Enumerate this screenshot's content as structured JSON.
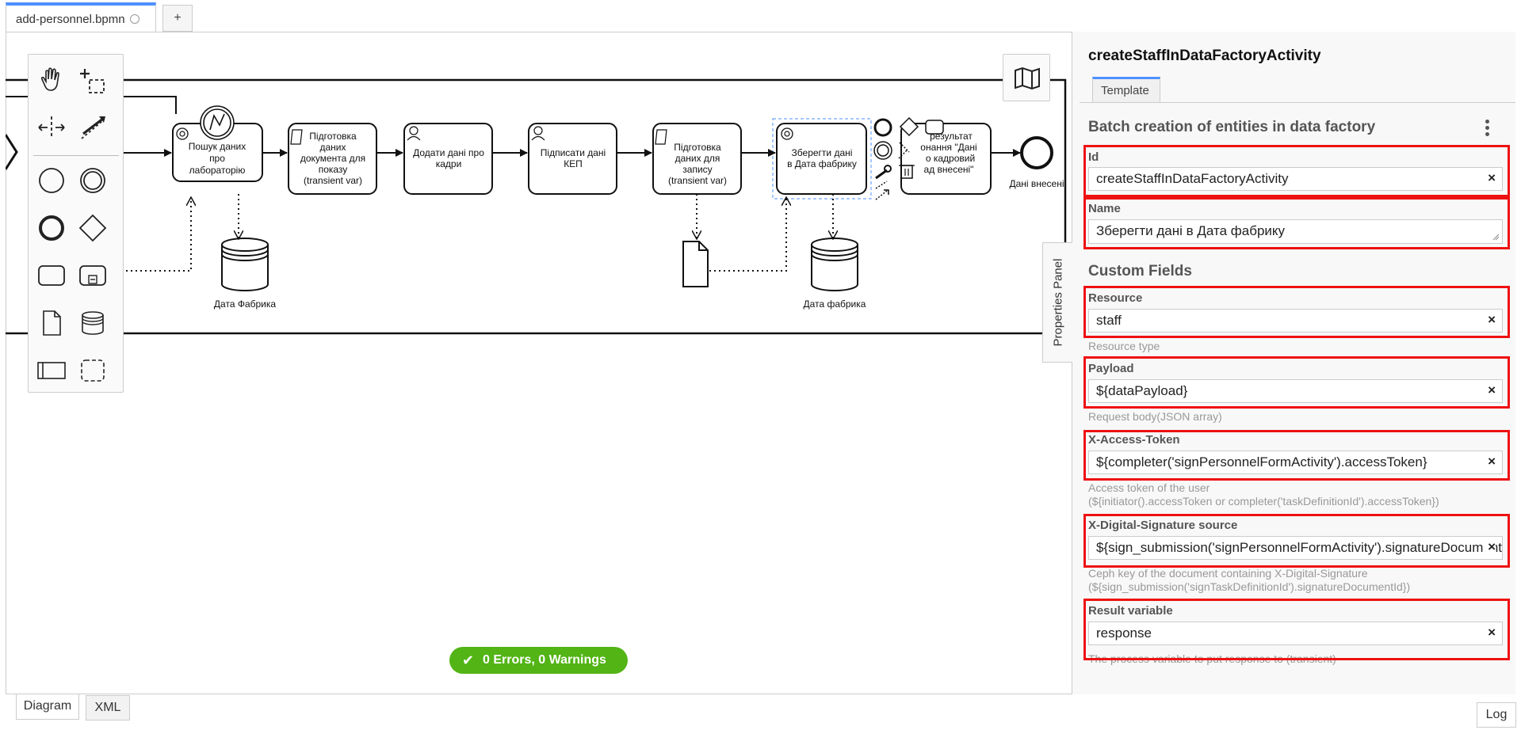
{
  "file_tab": {
    "name": "add-personnel.bpmn",
    "add_label": "+"
  },
  "diagram": {
    "tasks": [
      {
        "label": "Пошук даних про лабораторію"
      },
      {
        "label": "Підготовка даних документа для показу (transient var)"
      },
      {
        "label": "Додати дані про кадри"
      },
      {
        "label": "Підписати дані КЕП"
      },
      {
        "label": "Підготовка даних для запису (transient var)"
      },
      {
        "label": "Зберегти дані в Дата фабрику"
      },
      {
        "label": "...ультат ...онання \"Дані ...о кадровий ...ад внесені\""
      }
    ],
    "partial_task_text": "а\nа\nя",
    "stores": [
      {
        "label": "Дата Фабрика"
      },
      {
        "label": "Дата фабрика"
      }
    ],
    "end_event_label": "Дані внесені"
  },
  "panel": {
    "toggle_label": "Properties Panel",
    "element_id": "createStaffInDataFactoryActivity",
    "tab_label": "Template",
    "group_title": "Batch creation of entities in data factory",
    "id_field": {
      "label": "Id",
      "value": "createStaffInDataFactoryActivity"
    },
    "name_field": {
      "label": "Name",
      "value": "Зберегти дані в Дата фабрику"
    },
    "custom_fields_title": "Custom Fields",
    "resource": {
      "label": "Resource",
      "value": "staff",
      "description": "Resource type"
    },
    "payload": {
      "label": "Payload",
      "value": "${dataPayload}",
      "description": "Request body(JSON array)"
    },
    "access_token": {
      "label": "X-Access-Token",
      "value": "${completer('signPersonnelFormActivity').accessToken}",
      "description_1": "Access token of the user",
      "description_2": "(${initiator().accessToken or completer('taskDefinitionId').accessToken})"
    },
    "signature": {
      "label": "X-Digital-Signature source",
      "value": "${sign_submission('signPersonnelFormActivity').signatureDocumentId}",
      "description_1": "Ceph key of the document containing X-Digital-Signature",
      "description_2": "(${sign_submission('signTaskDefinitionId').signatureDocumentId})"
    },
    "result_variable": {
      "label": "Result variable",
      "value": "response",
      "description": "The process variable to put response to (transient)"
    },
    "clear_glyph": "×"
  },
  "status": {
    "errors_warnings": "0 Errors, 0 Warnings",
    "check_glyph": "✔"
  },
  "bottom_tabs": {
    "diagram": "Diagram",
    "xml": "XML",
    "log": "Log"
  },
  "colors": {
    "accent": "#4d90fe",
    "highlight": "#ee1111",
    "success": "#52b415"
  }
}
